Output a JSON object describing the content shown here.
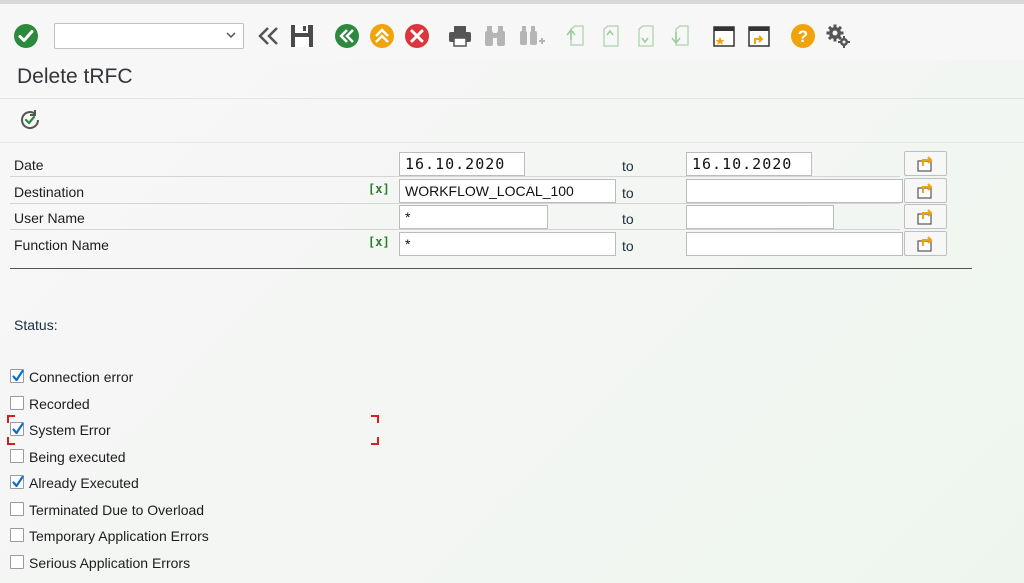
{
  "window": {
    "title": "Delete tRFC"
  },
  "toolbar": {
    "command_value": "",
    "icons": [
      "enter-icon",
      "back-double-icon",
      "save-icon",
      "back-icon",
      "exit-icon",
      "cancel-icon",
      "print-icon",
      "find-icon",
      "find-next-icon",
      "first-page-icon",
      "previous-page-icon",
      "next-page-icon",
      "last-page-icon",
      "create-session-icon",
      "shortcut-icon",
      "help-icon",
      "settings-icon"
    ]
  },
  "selection": {
    "rows": [
      {
        "label": "Date",
        "low": "16.10.2020",
        "to": "to",
        "high": "16.10.2020",
        "multi": ""
      },
      {
        "label": "Destination",
        "low": "WORKFLOW_LOCAL_100",
        "to": "to",
        "high": "",
        "multi": "[x]"
      },
      {
        "label": "User Name",
        "low": "*",
        "to": "to",
        "high": "",
        "multi": ""
      },
      {
        "label": "Function Name",
        "low": "*",
        "to": "to",
        "high": "",
        "multi": "[x]"
      }
    ]
  },
  "status": {
    "label": "Status:",
    "options": [
      {
        "label": "Connection error",
        "checked": true
      },
      {
        "label": "Recorded",
        "checked": false
      },
      {
        "label": "System Error",
        "checked": true
      },
      {
        "label": "Being executed",
        "checked": false
      },
      {
        "label": "Already Executed",
        "checked": true
      },
      {
        "label": "Terminated Due to Overload",
        "checked": false
      },
      {
        "label": "Temporary Application Errors",
        "checked": false
      },
      {
        "label": "Serious Application Errors",
        "checked": false
      }
    ]
  },
  "colors": {
    "accent_green": "#2b8a3e",
    "accent_orange": "#f0a30a",
    "cancel_red": "#d9363e",
    "check_blue": "#0a6ed1"
  }
}
